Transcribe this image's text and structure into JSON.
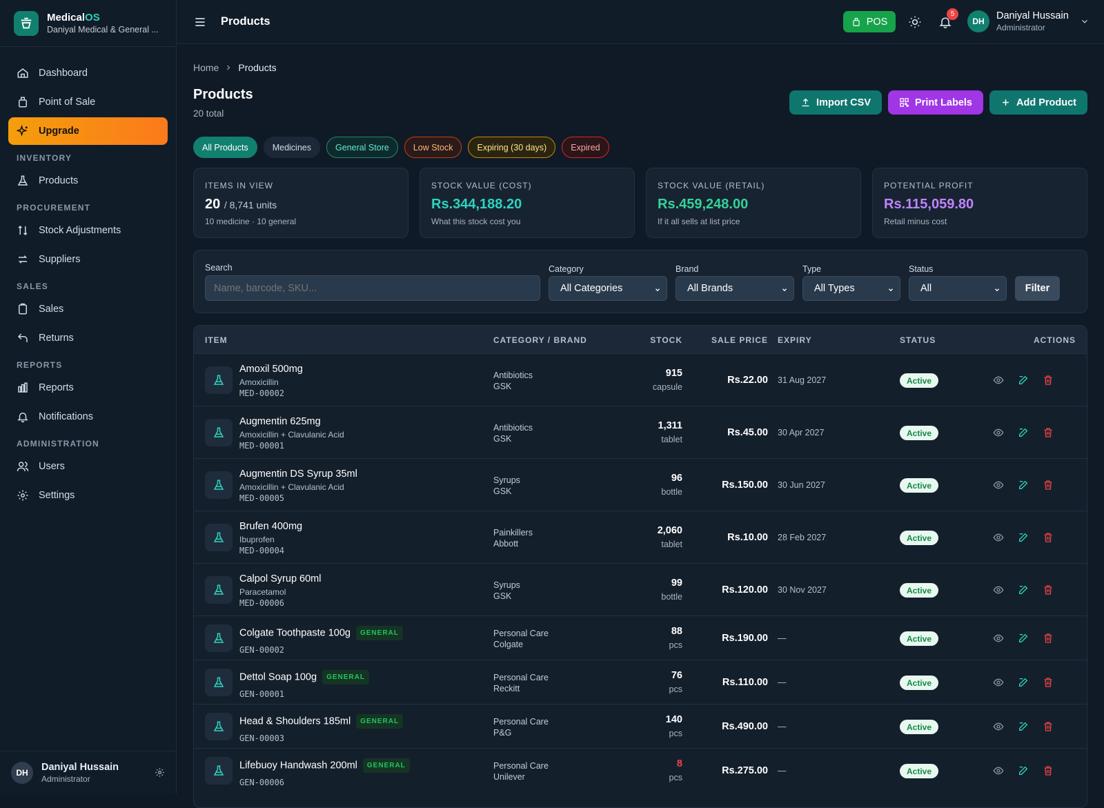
{
  "app": {
    "name_main": "Medical",
    "name_accent": "OS",
    "org": "Daniyal Medical & General ..."
  },
  "sidebar": {
    "items_top": [
      {
        "label": "Dashboard",
        "icon": "home-icon"
      },
      {
        "label": "Point of Sale",
        "icon": "register-icon"
      },
      {
        "label": "Upgrade",
        "icon": "sparkle-icon"
      }
    ],
    "sections": [
      {
        "title": "INVENTORY",
        "items": [
          {
            "label": "Products",
            "icon": "flask-icon"
          }
        ]
      },
      {
        "title": "PROCUREMENT",
        "items": [
          {
            "label": "Stock Adjustments",
            "icon": "arrows-updown-icon"
          },
          {
            "label": "Suppliers",
            "icon": "swap-icon"
          }
        ]
      },
      {
        "title": "SALES",
        "items": [
          {
            "label": "Sales",
            "icon": "clipboard-icon"
          },
          {
            "label": "Returns",
            "icon": "return-icon"
          }
        ]
      },
      {
        "title": "REPORTS",
        "items": [
          {
            "label": "Reports",
            "icon": "bar-chart-icon"
          },
          {
            "label": "Notifications",
            "icon": "bell-icon"
          }
        ]
      },
      {
        "title": "ADMINISTRATION",
        "items": [
          {
            "label": "Users",
            "icon": "users-icon"
          },
          {
            "label": "Settings",
            "icon": "gear-icon"
          }
        ]
      }
    ],
    "user": {
      "initials": "DH",
      "name": "Daniyal Hussain",
      "role": "Administrator"
    }
  },
  "header": {
    "title": "Products",
    "pos_label": "POS",
    "notif_count": "5",
    "user": {
      "initials": "DH",
      "name": "Daniyal Hussain",
      "role": "Administrator"
    }
  },
  "breadcrumb": {
    "home": "Home",
    "current": "Products"
  },
  "page": {
    "title": "Products",
    "subtitle": "20 total"
  },
  "actions": {
    "import": "Import CSV",
    "print": "Print Labels",
    "add": "Add Product"
  },
  "chips": [
    "All Products",
    "Medicines",
    "General Store",
    "Low Stock",
    "Expiring (30 days)",
    "Expired"
  ],
  "stats": [
    {
      "label": "ITEMS IN VIEW",
      "value": "20",
      "value_suffix": "/ 8,741 units",
      "sub": "10 medicine · 10 general",
      "color": "#ffffff"
    },
    {
      "label": "STOCK VALUE (COST)",
      "value": "Rs.344,188.20",
      "sub": "What this stock cost you",
      "color": "#2dd4bf"
    },
    {
      "label": "STOCK VALUE (RETAIL)",
      "value": "Rs.459,248.00",
      "sub": "If it all sells at list price",
      "color": "#34d399"
    },
    {
      "label": "POTENTIAL PROFIT",
      "value": "Rs.115,059.80",
      "sub": "Retail minus cost",
      "color": "#c084fc"
    }
  ],
  "filters": {
    "search_label": "Search",
    "search_placeholder": "Name, barcode, SKU...",
    "category_label": "Category",
    "category_value": "All Categories",
    "brand_label": "Brand",
    "brand_value": "All Brands",
    "type_label": "Type",
    "type_value": "All Types",
    "status_label": "Status",
    "status_value": "All",
    "filter_button": "Filter"
  },
  "table": {
    "columns": [
      "ITEM",
      "CATEGORY / BRAND",
      "STOCK",
      "SALE PRICE",
      "EXPIRY",
      "STATUS",
      "ACTIONS"
    ],
    "rows": [
      {
        "name": "Amoxil 500mg",
        "generic": "Amoxicillin",
        "sku": "MED-00002",
        "category": "Antibiotics",
        "brand": "GSK",
        "stock": "915",
        "unit": "capsule",
        "price": "Rs.22.00",
        "expiry": "31 Aug 2027",
        "status": "Active"
      },
      {
        "name": "Augmentin 625mg",
        "generic": "Amoxicillin + Clavulanic Acid",
        "sku": "MED-00001",
        "category": "Antibiotics",
        "brand": "GSK",
        "stock": "1,311",
        "unit": "tablet",
        "price": "Rs.45.00",
        "expiry": "30 Apr 2027",
        "status": "Active"
      },
      {
        "name": "Augmentin DS Syrup 35ml",
        "generic": "Amoxicillin + Clavulanic Acid",
        "sku": "MED-00005",
        "category": "Syrups",
        "brand": "GSK",
        "stock": "96",
        "unit": "bottle",
        "price": "Rs.150.00",
        "expiry": "30 Jun 2027",
        "status": "Active"
      },
      {
        "name": "Brufen 400mg",
        "generic": "Ibuprofen",
        "sku": "MED-00004",
        "category": "Painkillers",
        "brand": "Abbott",
        "stock": "2,060",
        "unit": "tablet",
        "price": "Rs.10.00",
        "expiry": "28 Feb 2027",
        "status": "Active"
      },
      {
        "name": "Calpol Syrup 60ml",
        "generic": "Paracetamol",
        "sku": "MED-00006",
        "category": "Syrups",
        "brand": "GSK",
        "stock": "99",
        "unit": "bottle",
        "price": "Rs.120.00",
        "expiry": "30 Nov 2027",
        "status": "Active"
      },
      {
        "name": "Colgate Toothpaste 100g",
        "tag": "GENERAL",
        "sku": "GEN-00002",
        "category": "Personal Care",
        "brand": "Colgate",
        "stock": "88",
        "unit": "pcs",
        "price": "Rs.190.00",
        "expiry": "—",
        "status": "Active"
      },
      {
        "name": "Dettol Soap 100g",
        "tag": "GENERAL",
        "sku": "GEN-00001",
        "category": "Personal Care",
        "brand": "Reckitt",
        "stock": "76",
        "unit": "pcs",
        "price": "Rs.110.00",
        "expiry": "—",
        "status": "Active"
      },
      {
        "name": "Head & Shoulders 185ml",
        "tag": "GENERAL",
        "sku": "GEN-00003",
        "category": "Personal Care",
        "brand": "P&G",
        "stock": "140",
        "unit": "pcs",
        "price": "Rs.490.00",
        "expiry": "—",
        "status": "Active"
      },
      {
        "name": "Lifebuoy Handwash 200ml",
        "tag": "GENERAL",
        "sku": "GEN-00006",
        "category": "Personal Care",
        "brand": "Unilever",
        "stock": "8",
        "unit": "pcs",
        "price": "Rs.275.00",
        "expiry": "—",
        "status": "Active",
        "low": true
      }
    ]
  }
}
